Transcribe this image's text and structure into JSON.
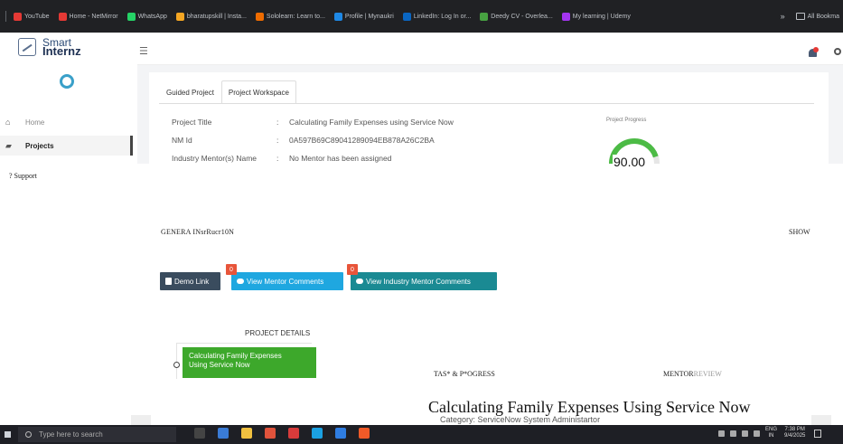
{
  "bookmarks": [
    {
      "label": "YouTube",
      "color": "#e53935"
    },
    {
      "label": "Home - NetMirror",
      "color": "#e53935"
    },
    {
      "label": "WhatsApp",
      "color": "#25d366"
    },
    {
      "label": "bharatupskill | Insta...",
      "color": "#f5a623"
    },
    {
      "label": "Sololearn: Learn to...",
      "color": "#ef6c00"
    },
    {
      "label": "Profile | Mynaukri",
      "color": "#1e88e5"
    },
    {
      "label": "LinkedIn: Log In or...",
      "color": "#0a66c2"
    },
    {
      "label": "Deedy CV - Overlea...",
      "color": "#47a141"
    },
    {
      "label": "My learning | Udemy",
      "color": "#a435f0"
    }
  ],
  "bookmarks_right": {
    "more": "»",
    "all_bookmarks": "All Bookma"
  },
  "brand": {
    "line1": "Smart",
    "line2": "Internz"
  },
  "icons": {
    "menu": "☰",
    "home": "⌂",
    "projects": "▰"
  },
  "nav": {
    "home": "Home",
    "projects": "Projects",
    "support": "? Support"
  },
  "tabs": [
    "Guided Project",
    "Project Workspace"
  ],
  "project_info": [
    {
      "key": "Project Title",
      "sep": ":",
      "value": "Calculating Family Expenses using Service Now"
    },
    {
      "key": "NM Id",
      "sep": ":",
      "value": "0A597B69C89041289094EB878A26C2BA"
    },
    {
      "key": "Industry Mentor(s) Name",
      "sep": ":",
      "value": "No Mentor has been assigned"
    }
  ],
  "progress": {
    "label": "Project Progress",
    "value_text": "90.00",
    "percent": 90,
    "color": "#4cbb45"
  },
  "sections": {
    "general_instruction": "GENERA INsrRucr10N",
    "show": "SHOW"
  },
  "buttons": {
    "demo": "Demo Link",
    "mentor_comments": "View Mentor Comments",
    "mentor_badge": "0",
    "industry_comments": "View Industry Mentor Comments",
    "industry_badge": "0"
  },
  "project_details": {
    "title": "PROJECT DETAILS",
    "item_line1": "Calculating Family Expenses",
    "item_line2": "Using Service Now"
  },
  "tasks_heading": "TAS* & P*OGRESS",
  "mentor_heading": {
    "main": "MENTOR",
    "faded": "REVIEW"
  },
  "task_title": "Calculating Family Expenses Using Service Now",
  "task_category": "Category: ServiceNow System Administartor",
  "taskbar": {
    "search_placeholder": "Type here to search",
    "lang1": "ENG",
    "lang2": "IN",
    "time": "7:38 PM",
    "date": "9/4/2025",
    "app_colors": [
      "#444",
      "#3a7bd5",
      "#f0c040",
      "#e0533c",
      "#d83b3b",
      "#1ba1e2",
      "#2f7de1",
      "#f05a28"
    ]
  }
}
